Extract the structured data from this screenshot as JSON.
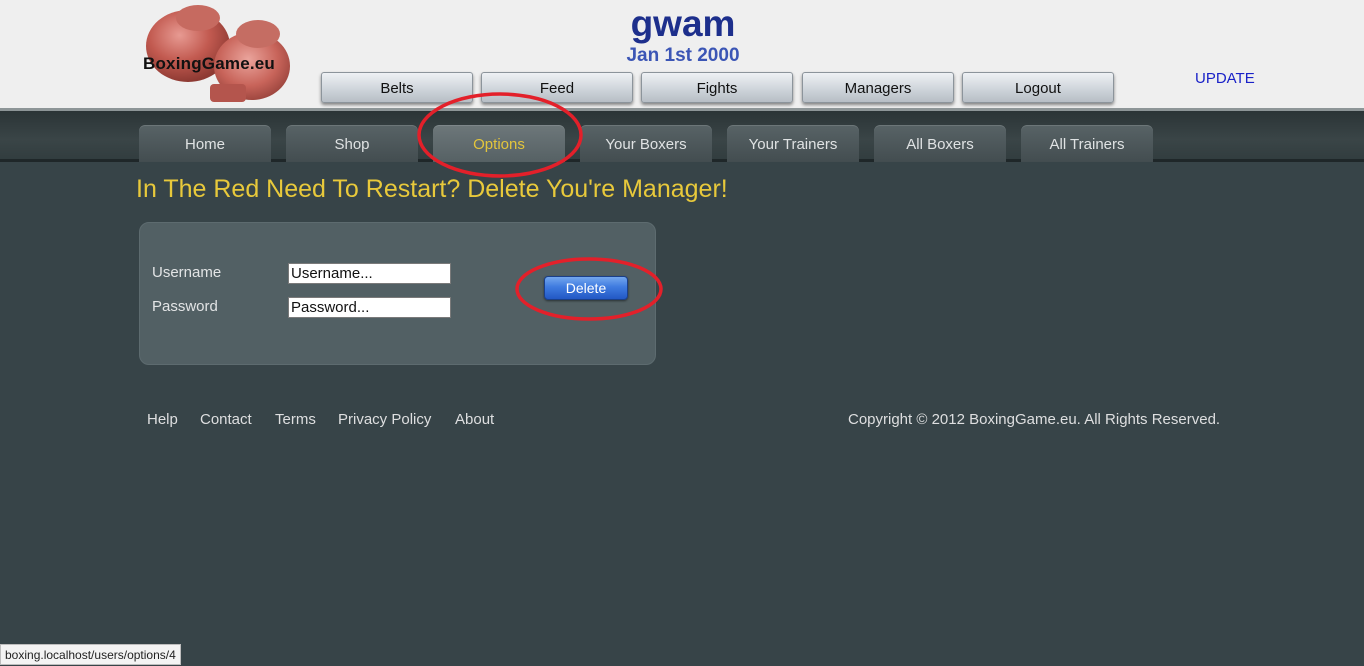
{
  "logo": {
    "text": "BoxingGame.eu"
  },
  "header": {
    "manager_name": "gwam",
    "date": "Jan 1st 2000",
    "update_link": "UPDATE"
  },
  "top_nav": [
    "Belts",
    "Feed",
    "Fights",
    "Managers",
    "Logout"
  ],
  "tabs": [
    {
      "label": "Home",
      "active": false
    },
    {
      "label": "Shop",
      "active": false
    },
    {
      "label": "Options",
      "active": true
    },
    {
      "label": "Your Boxers",
      "active": false
    },
    {
      "label": "Your Trainers",
      "active": false
    },
    {
      "label": "All Boxers",
      "active": false
    },
    {
      "label": "All Trainers",
      "active": false
    }
  ],
  "page": {
    "heading": "In The Red Need To Restart? Delete You're Manager!"
  },
  "form": {
    "username_label": "Username",
    "username_placeholder": "Username...",
    "password_label": "Password",
    "password_placeholder": "Password...",
    "delete_label": "Delete"
  },
  "footer": {
    "links": [
      "Help",
      "Contact",
      "Terms",
      "Privacy Policy",
      "About"
    ],
    "copyright": "Copyright © 2012 BoxingGame.eu. All Rights Reserved."
  },
  "status_bar": {
    "url": "boxing.localhost/users/options/4"
  },
  "colors": {
    "heading": "#e8c93b",
    "active_tab_text": "#e3c53c",
    "annotation": "#e3202a",
    "update_link": "#1a22c8",
    "manager_name": "#1d2f8c"
  },
  "icons": [
    "boxing-gloves-logo-icon"
  ]
}
